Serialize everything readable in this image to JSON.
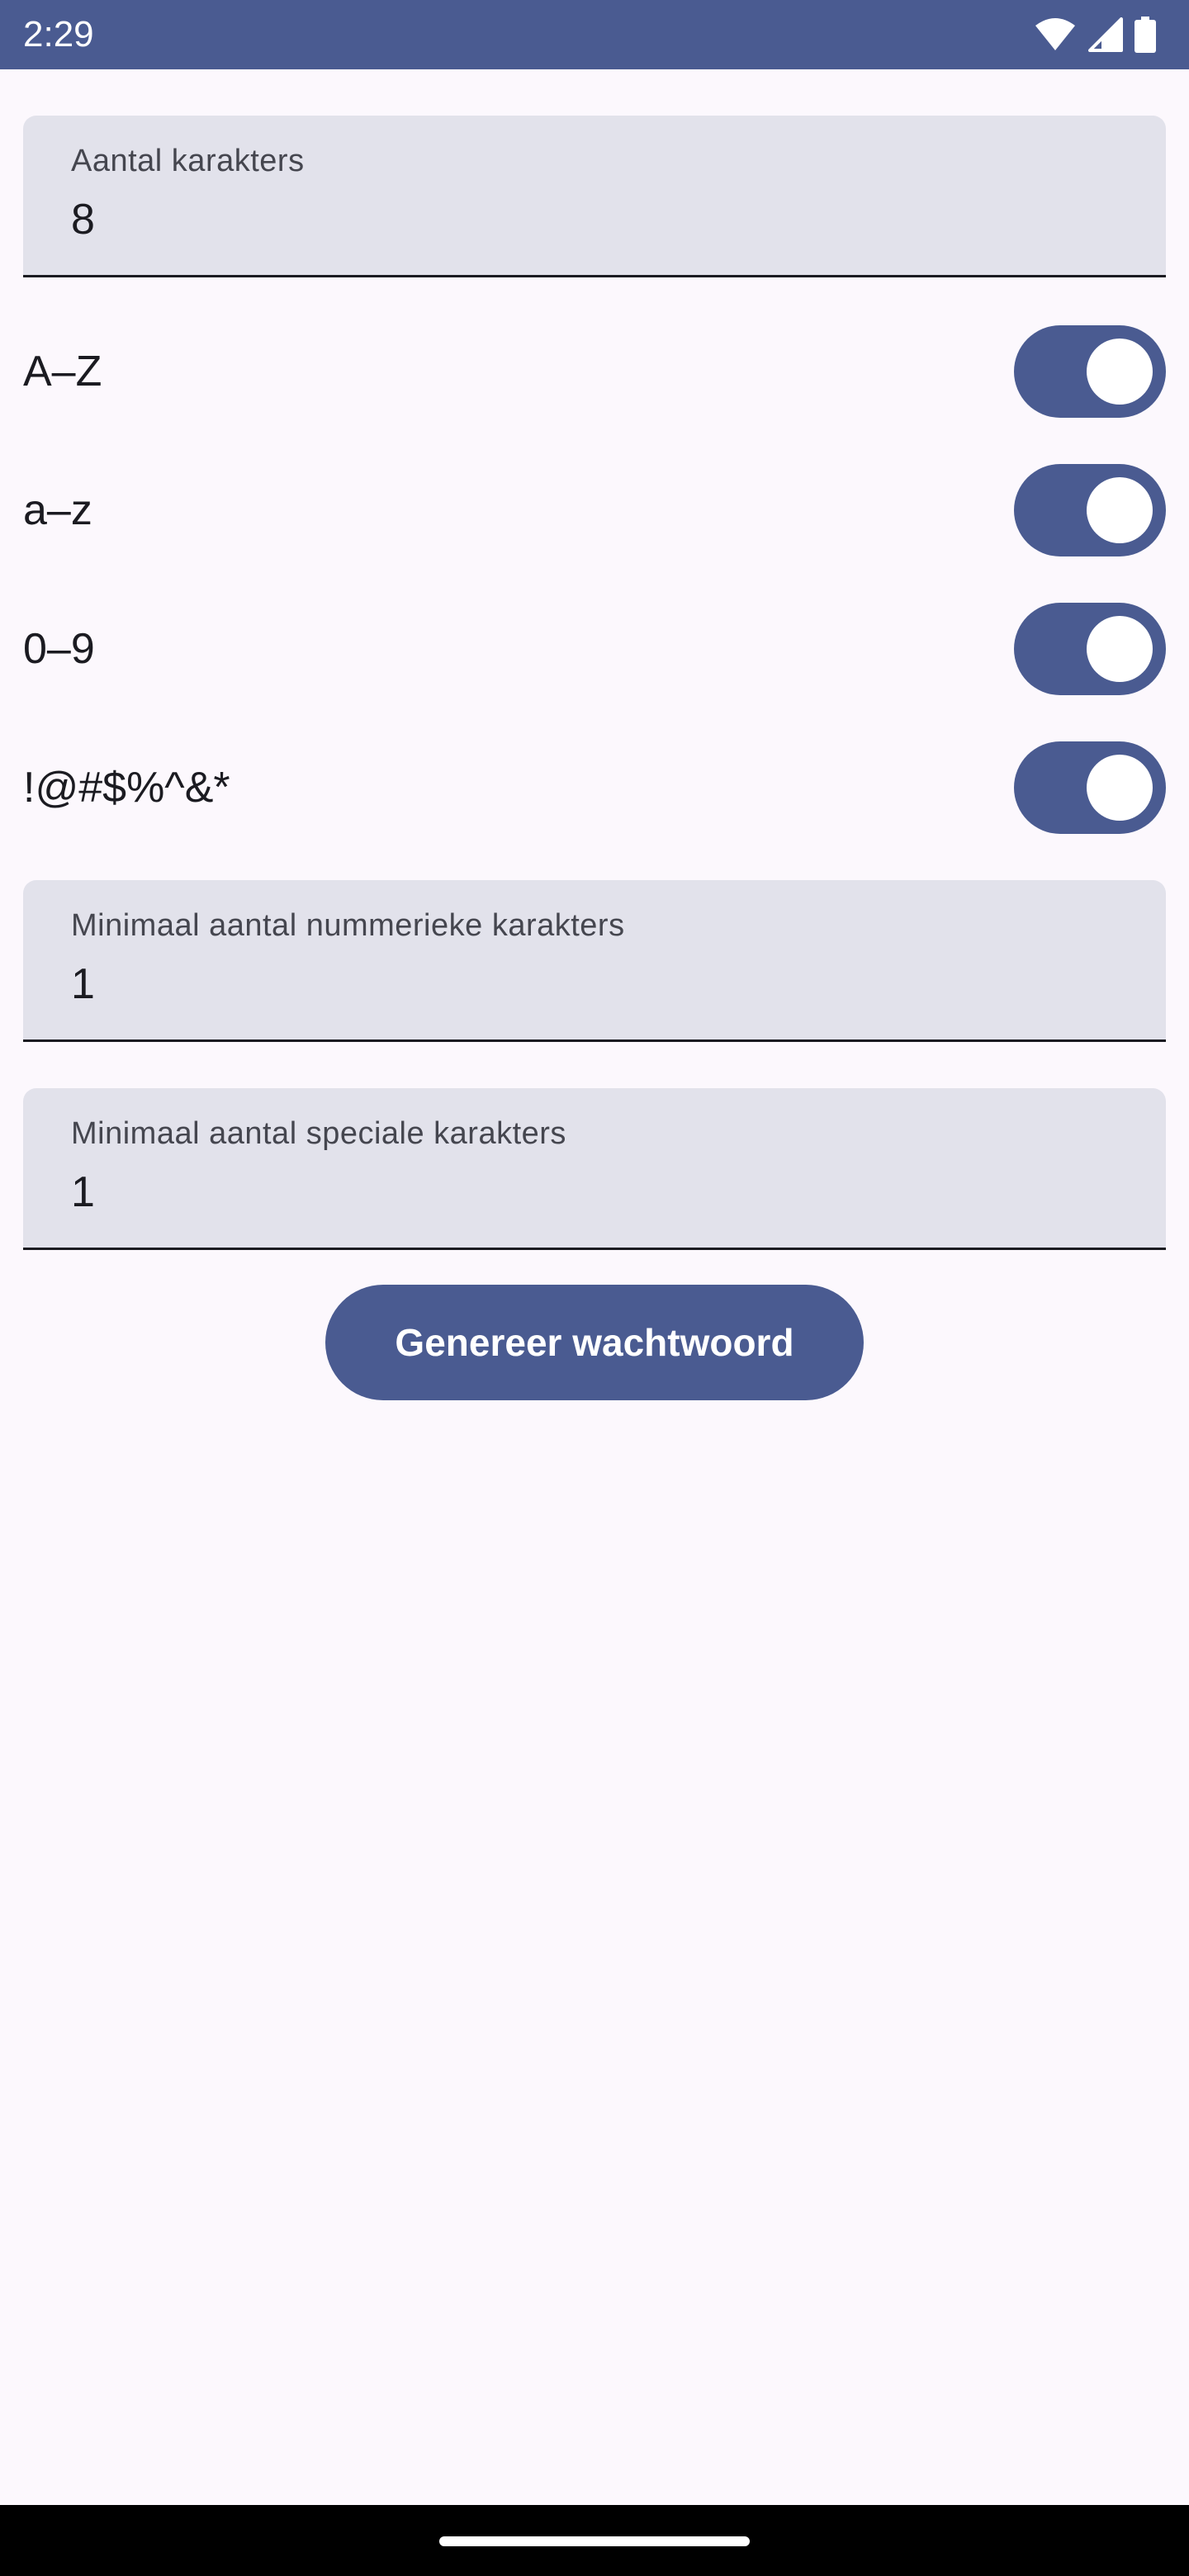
{
  "status_bar": {
    "time": "2:29",
    "icons": [
      "wifi-icon",
      "cell-signal-icon",
      "battery-icon"
    ]
  },
  "fields": {
    "length": {
      "label": "Aantal karakters",
      "value": "8"
    },
    "min_numeric": {
      "label": "Minimaal aantal nummerieke karakters",
      "value": "1"
    },
    "min_special": {
      "label": "Minimaal aantal speciale karakters",
      "value": "1"
    }
  },
  "switches": [
    {
      "label": "A–Z",
      "on": true
    },
    {
      "label": "a–z",
      "on": true
    },
    {
      "label": "0–9",
      "on": true
    },
    {
      "label": "!@#$%^&*",
      "on": true
    }
  ],
  "generate_button": {
    "label": "Genereer wachtwoord"
  },
  "colors": {
    "primary": "#4A5B91",
    "background": "#FCF8FD",
    "field_fill": "#E2E2EB",
    "on_surface": "#1B1B21"
  }
}
